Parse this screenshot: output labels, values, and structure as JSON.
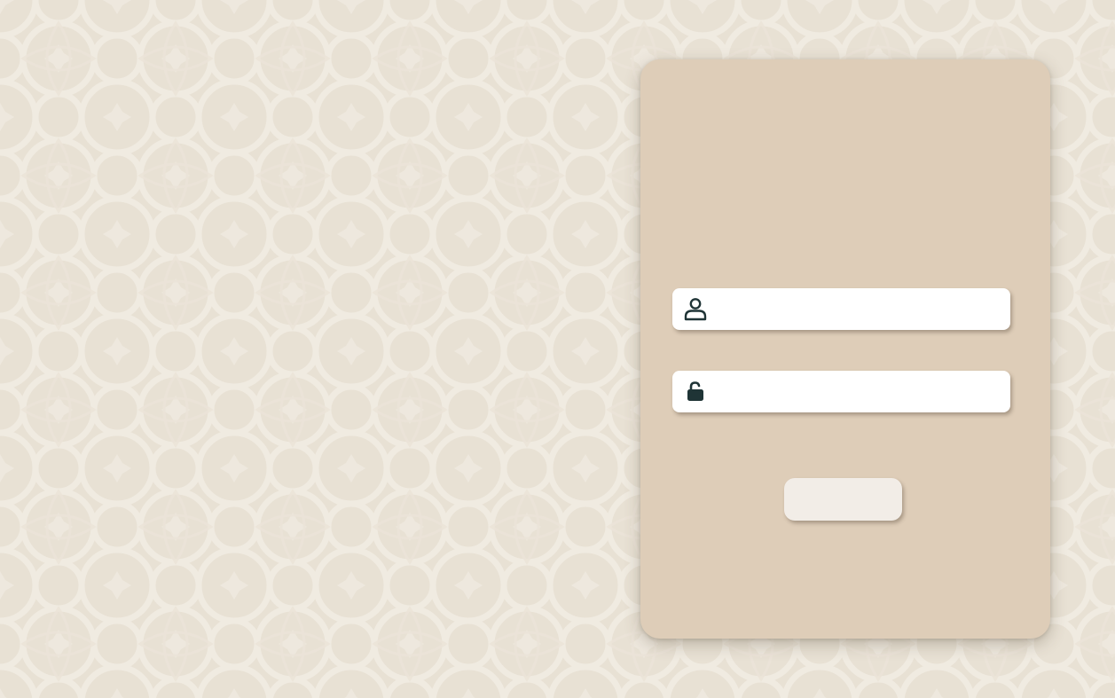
{
  "background": {
    "color": "#e8e1d4",
    "pattern": "geometric-star-lattice"
  },
  "login_card": {
    "color": "#decdb8",
    "username": {
      "icon": "user-icon",
      "value": "",
      "placeholder": ""
    },
    "password": {
      "icon": "lock-open-icon",
      "value": "",
      "placeholder": ""
    },
    "submit": {
      "label": ""
    }
  }
}
